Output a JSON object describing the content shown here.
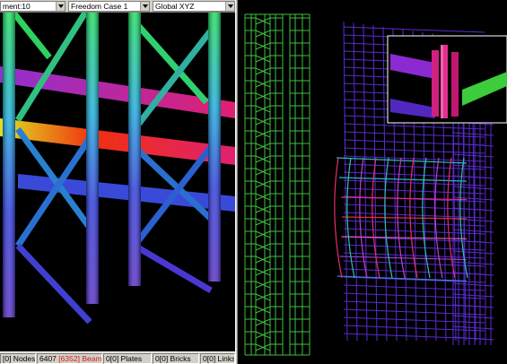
{
  "toolbar": {
    "element_combo": "ment:10",
    "case_combo": "Freedom Case 1",
    "axis_combo": "Global XYZ"
  },
  "status": {
    "nodes": "[0] Nodes",
    "beams_count": "6407",
    "beams_sel": "[6352]",
    "beams_label": "Beams",
    "plates": "0[0] Plates",
    "bricks": "0[0] Bricks",
    "links": "0[0] Links"
  },
  "colors": {
    "toolbar_bg": "#d4d0c8",
    "viewport_bg": "#000000",
    "mesh_green": "#3fbf3f",
    "mesh_purple": "#5a2bd0",
    "highlight_red": "#e0206a"
  },
  "icons": [
    "dropdown-arrow-icon"
  ]
}
